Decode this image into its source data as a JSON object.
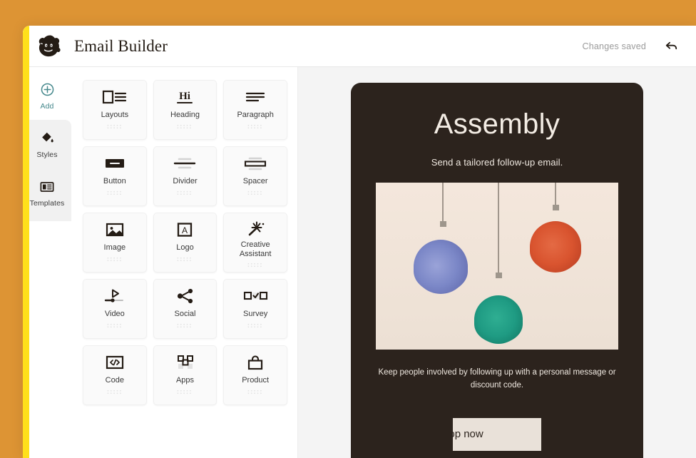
{
  "window": {
    "background_color": "#dd9434",
    "accent_rail_color": "#ffe01b"
  },
  "header": {
    "logo_icon": "mailchimp-freddie-icon",
    "title": "Email Builder",
    "save_status": "Changes saved",
    "undo_icon": "undo-arrow-icon"
  },
  "sidebar": {
    "items": [
      {
        "label": "Add",
        "icon": "plus-circle-icon",
        "active": true
      },
      {
        "label": "Styles",
        "icon": "paint-bucket-icon",
        "active": false
      },
      {
        "label": "Templates",
        "icon": "template-grid-icon",
        "active": false
      }
    ],
    "active_color": "#45888c"
  },
  "palette": {
    "blocks": [
      {
        "label": "Layouts",
        "icon": "layout-columns-icon"
      },
      {
        "label": "Heading",
        "icon": "heading-hi-icon"
      },
      {
        "label": "Paragraph",
        "icon": "paragraph-lines-icon"
      },
      {
        "label": "Button",
        "icon": "button-pill-icon"
      },
      {
        "label": "Divider",
        "icon": "divider-rule-icon"
      },
      {
        "label": "Spacer",
        "icon": "spacer-bar-icon"
      },
      {
        "label": "Image",
        "icon": "image-picture-icon"
      },
      {
        "label": "Logo",
        "icon": "logo-letter-a-icon"
      },
      {
        "label": "Creative Assistant",
        "icon": "magic-wand-sparkle-icon"
      },
      {
        "label": "Video",
        "icon": "video-play-slider-icon"
      },
      {
        "label": "Social",
        "icon": "social-share-nodes-icon"
      },
      {
        "label": "Survey",
        "icon": "survey-checkbox-icon"
      },
      {
        "label": "Code",
        "icon": "code-brackets-icon"
      },
      {
        "label": "Apps",
        "icon": "apps-squares-icon"
      },
      {
        "label": "Product",
        "icon": "product-bag-icon"
      }
    ],
    "drag_handle_icon": "drag-dots-icon"
  },
  "email": {
    "background_color": "#2c231d",
    "heading": "Assembly",
    "subtitle": "Send a tailored follow-up email.",
    "body_text": "Keep people involved by following up with a personal message or discount code.",
    "cta_label": "Shop now",
    "hero": {
      "background_color": "#f0e2d6",
      "alt": "three hanging pendant lamps",
      "lamps": [
        {
          "name": "blue-pendant-lamp",
          "color": "#7b87c7"
        },
        {
          "name": "teal-pendant-lamp",
          "color": "#1f9b83"
        },
        {
          "name": "orange-pendant-lamp",
          "color": "#d9542f"
        }
      ]
    }
  }
}
